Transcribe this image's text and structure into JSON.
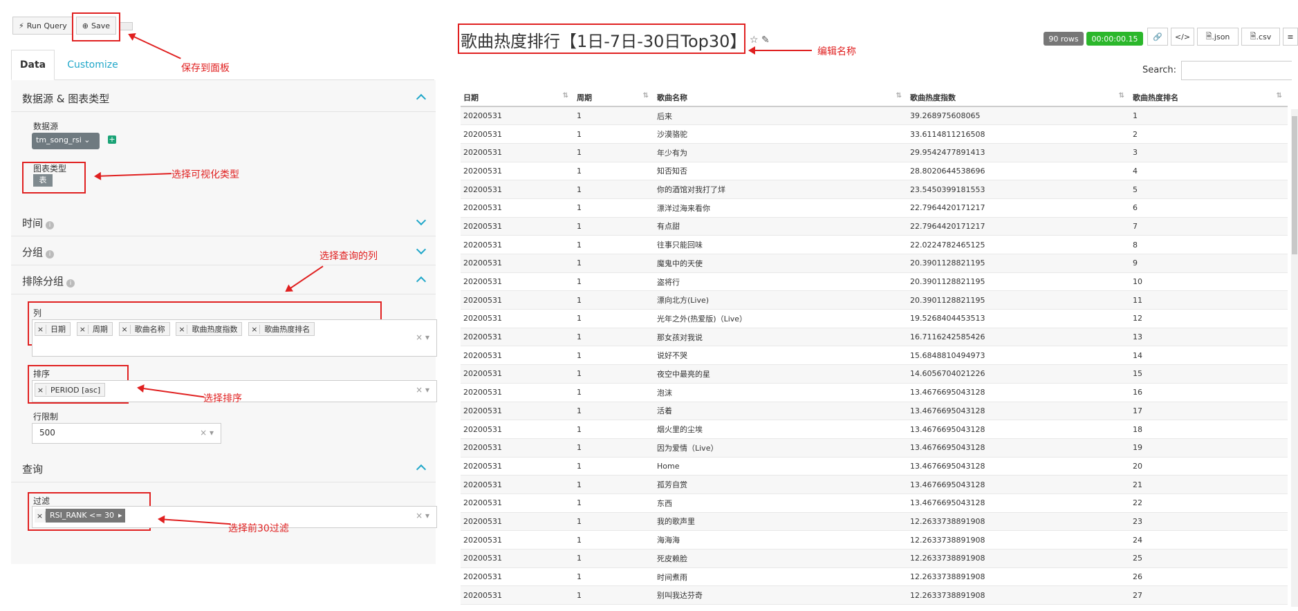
{
  "toolbar": {
    "run_query": "Run Query",
    "save": "Save"
  },
  "tabs": {
    "data": "Data",
    "customize": "Customize"
  },
  "sections": {
    "datasource_chart": "数据源 & 图表类型",
    "time": "时间",
    "group": "分组",
    "not_group": "排除分组",
    "query": "查询"
  },
  "datasource": {
    "label": "数据源",
    "value": "tm_song_rsi"
  },
  "viz": {
    "label": "图表类型",
    "value": "表"
  },
  "columns": {
    "label": "列",
    "items": [
      "日期",
      "周期",
      "歌曲名称",
      "歌曲热度指数",
      "歌曲热度排名"
    ]
  },
  "ordering": {
    "label": "排序",
    "value": "PERIOD [asc]"
  },
  "row_limit": {
    "label": "行限制",
    "value": "500"
  },
  "filter": {
    "label": "过滤",
    "value": "RSI_RANK <= 30"
  },
  "annotations": {
    "save": "保存到面板",
    "viz": "选择可视化类型",
    "columns": "选择查询的列",
    "ordering": "选择排序",
    "filter": "选择前30过滤",
    "title": "编辑名称"
  },
  "chart": {
    "title": "歌曲热度排行【1日-7日-30日Top30】",
    "rows_badge": "90 rows",
    "time_badge": "00:00:00.15",
    "json_btn": ".json",
    "csv_btn": ".csv",
    "search_label": "Search:"
  },
  "table": {
    "headers": [
      "日期",
      "周期",
      "歌曲名称",
      "歌曲热度指数",
      "歌曲热度排名"
    ],
    "rows": [
      [
        "20200531",
        "1",
        "后来",
        "39.268975608065",
        "1"
      ],
      [
        "20200531",
        "1",
        "沙漠骆驼",
        "33.6114811216508",
        "2"
      ],
      [
        "20200531",
        "1",
        "年少有为",
        "29.9542477891413",
        "3"
      ],
      [
        "20200531",
        "1",
        "知否知否",
        "28.8020644538696",
        "4"
      ],
      [
        "20200531",
        "1",
        "你的酒馆对我打了烊",
        "23.5450399181553",
        "5"
      ],
      [
        "20200531",
        "1",
        "漂洋过海来看你",
        "22.7964420171217",
        "6"
      ],
      [
        "20200531",
        "1",
        "有点甜",
        "22.7964420171217",
        "7"
      ],
      [
        "20200531",
        "1",
        "往事只能回味",
        "22.0224782465125",
        "8"
      ],
      [
        "20200531",
        "1",
        "魔鬼中的天使",
        "20.3901128821195",
        "9"
      ],
      [
        "20200531",
        "1",
        "盗将行",
        "20.3901128821195",
        "10"
      ],
      [
        "20200531",
        "1",
        "漂向北方(Live)",
        "20.3901128821195",
        "11"
      ],
      [
        "20200531",
        "1",
        "光年之外(热爱版)（Live）",
        "19.5268404453513",
        "12"
      ],
      [
        "20200531",
        "1",
        "那女孩对我说",
        "16.7116242585426",
        "13"
      ],
      [
        "20200531",
        "1",
        "说好不哭",
        "15.6848810494973",
        "14"
      ],
      [
        "20200531",
        "1",
        "夜空中最亮的星",
        "14.6056704021226",
        "15"
      ],
      [
        "20200531",
        "1",
        "泡沫",
        "13.4676695043128",
        "16"
      ],
      [
        "20200531",
        "1",
        "活着",
        "13.4676695043128",
        "17"
      ],
      [
        "20200531",
        "1",
        "烟火里的尘埃",
        "13.4676695043128",
        "18"
      ],
      [
        "20200531",
        "1",
        "因为爱情（Live）",
        "13.4676695043128",
        "19"
      ],
      [
        "20200531",
        "1",
        "Home",
        "13.4676695043128",
        "20"
      ],
      [
        "20200531",
        "1",
        "孤芳自赏",
        "13.4676695043128",
        "21"
      ],
      [
        "20200531",
        "1",
        "东西",
        "13.4676695043128",
        "22"
      ],
      [
        "20200531",
        "1",
        "我的歌声里",
        "12.2633738891908",
        "23"
      ],
      [
        "20200531",
        "1",
        "海海海",
        "12.2633738891908",
        "24"
      ],
      [
        "20200531",
        "1",
        "死皮赖脸",
        "12.2633738891908",
        "25"
      ],
      [
        "20200531",
        "1",
        "时间煮雨",
        "12.2633738891908",
        "26"
      ],
      [
        "20200531",
        "1",
        "别叫我达芬奇",
        "12.2633738891908",
        "27"
      ]
    ]
  }
}
